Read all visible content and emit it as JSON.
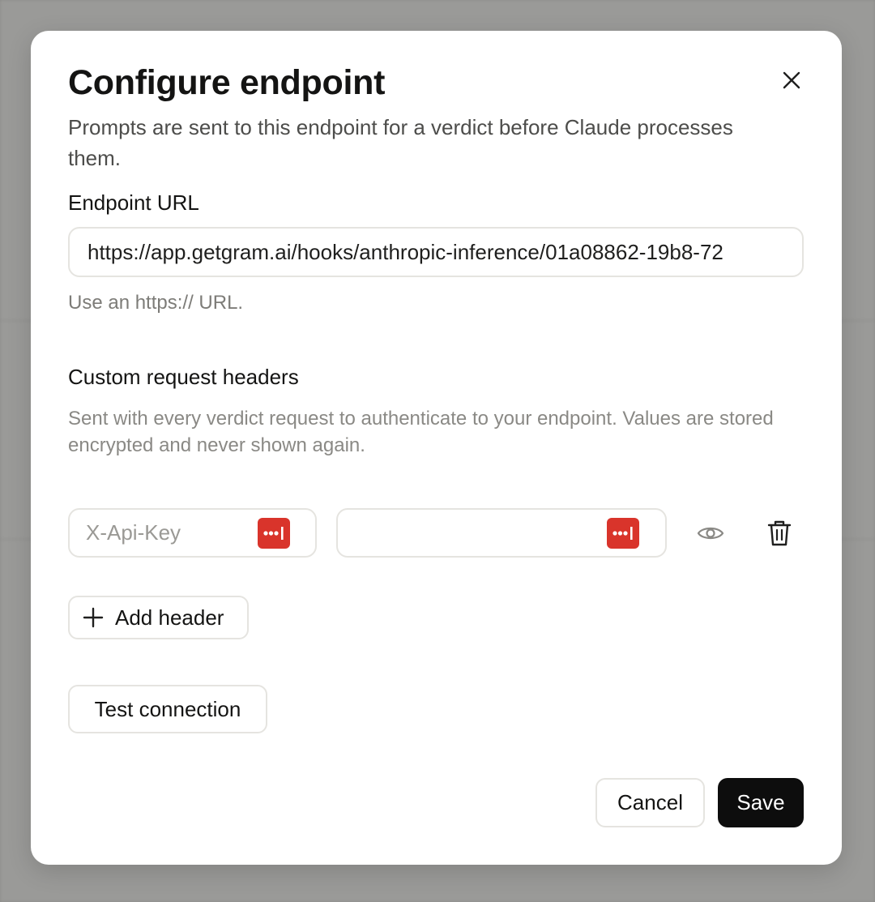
{
  "dialog": {
    "title": "Configure endpoint",
    "subtitle": "Prompts are sent to this endpoint for a verdict before Claude processes them.",
    "endpoint_label": "Endpoint URL",
    "endpoint_value": "https://app.getgram.ai/hooks/anthropic-inference/01a08862-19b8-72",
    "endpoint_hint": "Use an https:// URL.",
    "headers_label": "Custom request headers",
    "headers_description": "Sent with every verdict request to authenticate to your endpoint. Values are stored encrypted and never shown again.",
    "header_rows": [
      {
        "name_placeholder": "X-Api-Key",
        "value": ""
      }
    ],
    "add_header_label": "Add header",
    "test_connection_label": "Test connection",
    "cancel_label": "Cancel",
    "save_label": "Save"
  },
  "icons": {
    "close": "close-icon",
    "password_manager": "password-manager-icon",
    "reveal": "eye-icon",
    "delete": "trash-icon",
    "add": "plus-icon"
  },
  "colors": {
    "primary_button": "#0d0d0d",
    "password_badge": "#d9342b"
  }
}
